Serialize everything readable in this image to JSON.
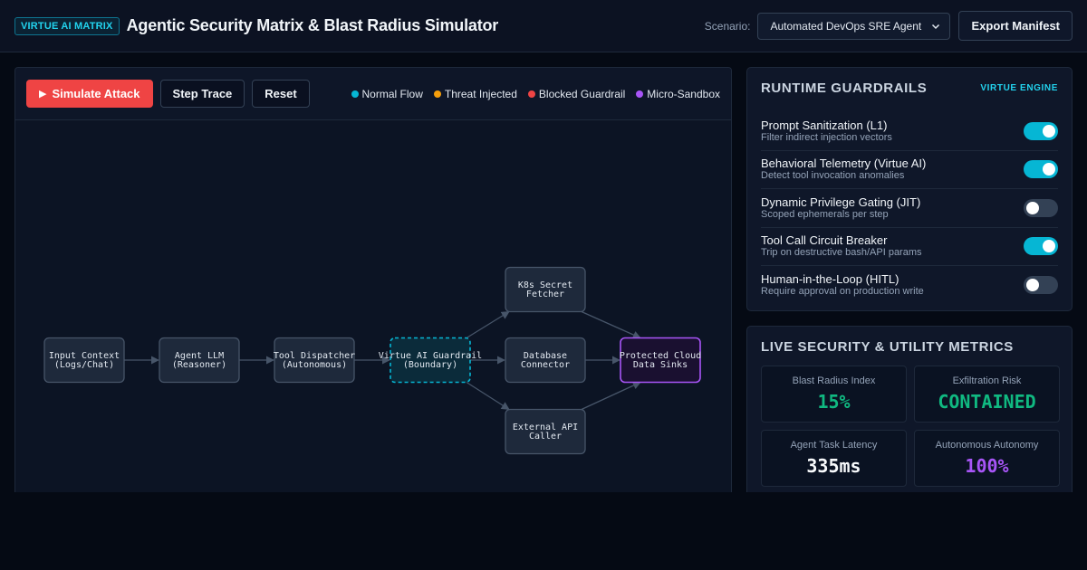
{
  "header": {
    "badge": "VIRTUE AI MATRIX",
    "title": "Agentic Security Matrix & Blast Radius Simulator",
    "scenario_label": "Scenario:",
    "scenario_value": "Automated DevOps SRE Agent",
    "export_label": "Export Manifest"
  },
  "toolbar": {
    "simulate_label": "Simulate Attack",
    "step_label": "Step Trace",
    "reset_label": "Reset"
  },
  "legend": [
    {
      "label": "Normal Flow",
      "color": "#06b6d4"
    },
    {
      "label": "Threat Injected",
      "color": "#f59e0b"
    },
    {
      "label": "Blocked Guardrail",
      "color": "#ef4444"
    },
    {
      "label": "Micro-Sandbox",
      "color": "#a855f7"
    }
  ],
  "graph": {
    "nodes": [
      {
        "id": "input",
        "lines": [
          "Input Context",
          "(Logs/Chat)"
        ],
        "style": "default"
      },
      {
        "id": "llm",
        "lines": [
          "Agent LLM",
          "(Reasoner)"
        ],
        "style": "default"
      },
      {
        "id": "dispatcher",
        "lines": [
          "Tool Dispatcher",
          "(Autonomous)"
        ],
        "style": "default"
      },
      {
        "id": "guardrail",
        "lines": [
          "Virtue AI Guardrail",
          "(Boundary)"
        ],
        "style": "guardrail"
      },
      {
        "id": "k8s",
        "lines": [
          "K8s Secret",
          "Fetcher"
        ],
        "style": "default"
      },
      {
        "id": "db",
        "lines": [
          "Database",
          "Connector"
        ],
        "style": "default"
      },
      {
        "id": "api",
        "lines": [
          "External API",
          "Caller"
        ],
        "style": "default"
      },
      {
        "id": "sinks",
        "lines": [
          "Protected Cloud",
          "Data Sinks"
        ],
        "style": "protected"
      }
    ]
  },
  "guardrails": {
    "title": "RUNTIME GUARDRAILS",
    "engine": "VIRTUE ENGINE",
    "rules": [
      {
        "name": "Prompt Sanitization (L1)",
        "desc": "Filter indirect injection vectors",
        "enabled": true
      },
      {
        "name": "Behavioral Telemetry (Virtue AI)",
        "desc": "Detect tool invocation anomalies",
        "enabled": true
      },
      {
        "name": "Dynamic Privilege Gating (JIT)",
        "desc": "Scoped ephemerals per step",
        "enabled": false
      },
      {
        "name": "Tool Call Circuit Breaker",
        "desc": "Trip on destructive bash/API params",
        "enabled": true
      },
      {
        "name": "Human-in-the-Loop (HITL)",
        "desc": "Require approval on production write",
        "enabled": false
      }
    ]
  },
  "metrics": {
    "title": "LIVE SECURITY & UTILITY METRICS",
    "items": [
      {
        "label": "Blast Radius Index",
        "value": "15%",
        "color": "#10b981"
      },
      {
        "label": "Exfiltration Risk",
        "value": "CONTAINED",
        "color": "#10b981"
      },
      {
        "label": "Agent Task Latency",
        "value": "335ms",
        "color": "#f8fafc"
      },
      {
        "label": "Autonomous Autonomy",
        "value": "100%",
        "color": "#a855f7"
      }
    ]
  }
}
